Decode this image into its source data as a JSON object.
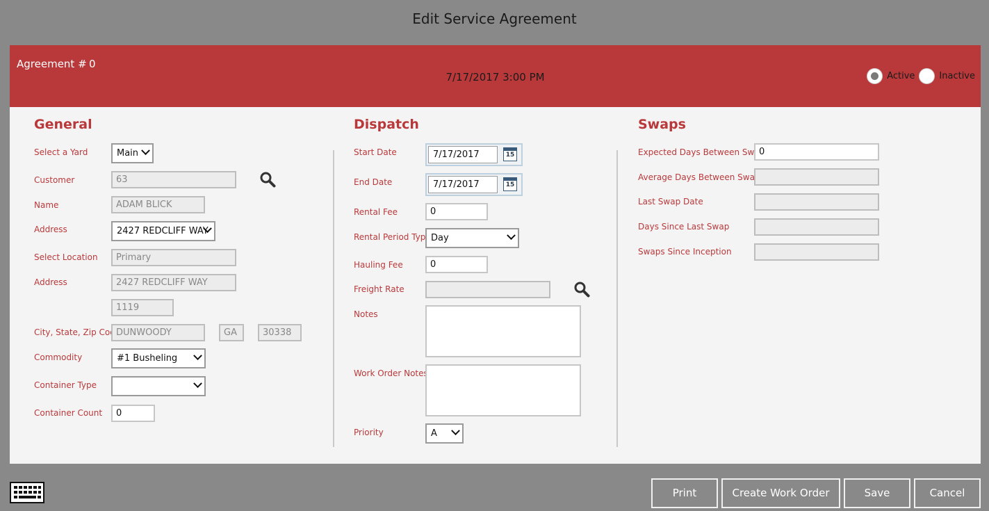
{
  "dialog": {
    "title": "Edit Service Agreement"
  },
  "header": {
    "agreement_label": "Agreement #",
    "agreement_number": "0",
    "datetime": "7/17/2017 3:00 PM",
    "status_active_label": "Active",
    "status_inactive_label": "Inactive",
    "selected_status": "Active"
  },
  "general": {
    "title": "General",
    "yard_label": "Select a Yard",
    "yard_value": "Main",
    "customer_label": "Customer",
    "customer_value": "63",
    "name_label": "Name",
    "name_value": "ADAM BLICK",
    "address_label": "Address",
    "address_value": "2427 REDCLIFF WAY",
    "location_label": "Select Location",
    "location_value": "Primary",
    "address2_label": "Address",
    "address2_value": "2427 REDCLIFF WAY",
    "address2_line2": "1119",
    "csz_label": "City, State, Zip Code",
    "city_value": "DUNWOODY",
    "state_value": "GA",
    "zip_value": "30338",
    "commodity_label": "Commodity",
    "commodity_value": "#1 Busheling",
    "container_type_label": "Container Type",
    "container_type_value": "",
    "container_count_label": "Container Count",
    "container_count_value": "0"
  },
  "dispatch": {
    "title": "Dispatch",
    "start_date_label": "Start Date",
    "start_date_value": "7/17/2017",
    "end_date_label": "End Date",
    "end_date_value": "7/17/2017",
    "rental_fee_label": "Rental Fee",
    "rental_fee_value": "0",
    "rental_period_label": "Rental Period Type",
    "rental_period_value": "Day",
    "hauling_fee_label": "Hauling Fee",
    "hauling_fee_value": "0",
    "freight_rate_label": "Freight Rate",
    "freight_rate_value": "",
    "notes_label": "Notes",
    "work_order_notes_label": "Work Order Notes",
    "priority_label": "Priority",
    "priority_value": "A",
    "calendar_day": "15"
  },
  "swaps": {
    "title": "Swaps",
    "expected_label": "Expected Days Between Swaps",
    "expected_value": "0",
    "average_label": "Average Days Between Swaps",
    "average_value": "",
    "last_swap_label": "Last Swap Date",
    "last_swap_value": "",
    "days_since_label": "Days Since Last Swap",
    "days_since_value": "",
    "since_inception_label": "Swaps Since Inception",
    "since_inception_value": ""
  },
  "footer": {
    "print_label": "Print",
    "create_work_order_label": "Create Work Order",
    "save_label": "Save",
    "cancel_label": "Cancel"
  },
  "colors": {
    "accent": "#b9393b",
    "panel": "#f4f4f4",
    "overlay": "#898989"
  },
  "icons": {
    "search": "search-icon",
    "calendar": "calendar-icon",
    "keyboard": "keyboard-icon"
  }
}
